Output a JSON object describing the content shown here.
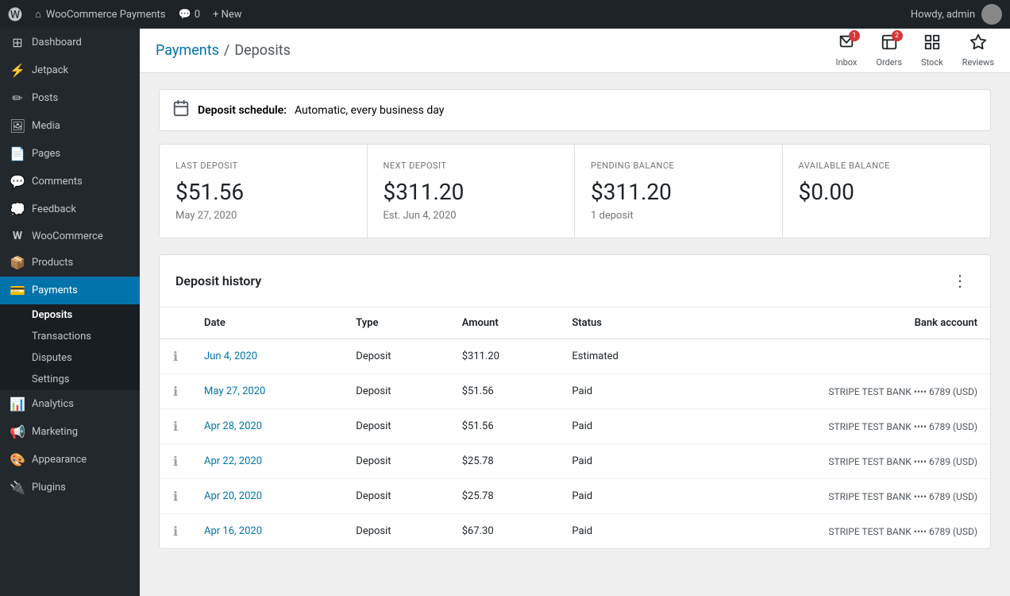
{
  "admin_bar": {
    "wp_logo": "W",
    "site_name": "WooCommerce Payments",
    "comments_icon": "💬",
    "comments_count": "0",
    "new_label": "+ New",
    "howdy": "Howdy, admin"
  },
  "sidebar": {
    "items": [
      {
        "id": "dashboard",
        "label": "Dashboard",
        "icon": "⊞"
      },
      {
        "id": "jetpack",
        "label": "Jetpack",
        "icon": "⚡"
      },
      {
        "id": "posts",
        "label": "Posts",
        "icon": "✏"
      },
      {
        "id": "media",
        "label": "Media",
        "icon": "🖼"
      },
      {
        "id": "pages",
        "label": "Pages",
        "icon": "📄"
      },
      {
        "id": "comments",
        "label": "Comments",
        "icon": "💬"
      },
      {
        "id": "feedback",
        "label": "Feedback",
        "icon": "💭"
      },
      {
        "id": "woocommerce",
        "label": "WooCommerce",
        "icon": "W"
      },
      {
        "id": "products",
        "label": "Products",
        "icon": "📦"
      },
      {
        "id": "payments",
        "label": "Payments",
        "icon": "💳",
        "active": true
      }
    ],
    "payments_submenu": [
      {
        "id": "deposits",
        "label": "Deposits",
        "active": true
      },
      {
        "id": "transactions",
        "label": "Transactions"
      },
      {
        "id": "disputes",
        "label": "Disputes"
      },
      {
        "id": "settings",
        "label": "Settings"
      }
    ],
    "bottom_items": [
      {
        "id": "analytics",
        "label": "Analytics",
        "icon": "📊"
      },
      {
        "id": "marketing",
        "label": "Marketing",
        "icon": "📢"
      },
      {
        "id": "appearance",
        "label": "Appearance",
        "icon": "🎨"
      },
      {
        "id": "plugins",
        "label": "Plugins",
        "icon": "🔌"
      }
    ]
  },
  "breadcrumb": {
    "parent_label": "Payments",
    "current_label": "Deposits"
  },
  "top_actions": [
    {
      "id": "inbox",
      "label": "Inbox",
      "icon": "📥",
      "badge": "1"
    },
    {
      "id": "orders",
      "label": "Orders",
      "icon": "📋",
      "badge": "2"
    },
    {
      "id": "stock",
      "label": "Stock",
      "icon": "⊞"
    },
    {
      "id": "reviews",
      "label": "Reviews",
      "icon": "★"
    }
  ],
  "deposit_schedule": {
    "icon": "📅",
    "label": "Deposit schedule:",
    "value": "Automatic, every business day"
  },
  "summary_cards": [
    {
      "id": "last_deposit",
      "label": "LAST DEPOSIT",
      "amount": "$51.56",
      "sub": "May 27, 2020"
    },
    {
      "id": "next_deposit",
      "label": "NEXT DEPOSIT",
      "amount": "$311.20",
      "sub": "Est. Jun 4, 2020"
    },
    {
      "id": "pending_balance",
      "label": "PENDING BALANCE",
      "amount": "$311.20",
      "sub": "1 deposit"
    },
    {
      "id": "available_balance",
      "label": "AVAILABLE BALANCE",
      "amount": "$0.00",
      "sub": ""
    }
  ],
  "deposit_history": {
    "title": "Deposit history",
    "columns": [
      "Date",
      "Type",
      "Amount",
      "Status",
      "Bank account"
    ],
    "rows": [
      {
        "date": "Jun 4, 2020",
        "type": "Deposit",
        "amount": "$311.20",
        "status": "Estimated",
        "bank": ""
      },
      {
        "date": "May 27, 2020",
        "type": "Deposit",
        "amount": "$51.56",
        "status": "Paid",
        "bank": "STRIPE TEST BANK •••• 6789 (USD)"
      },
      {
        "date": "Apr 28, 2020",
        "type": "Deposit",
        "amount": "$51.56",
        "status": "Paid",
        "bank": "STRIPE TEST BANK •••• 6789 (USD)"
      },
      {
        "date": "Apr 22, 2020",
        "type": "Deposit",
        "amount": "$25.78",
        "status": "Paid",
        "bank": "STRIPE TEST BANK •••• 6789 (USD)"
      },
      {
        "date": "Apr 20, 2020",
        "type": "Deposit",
        "amount": "$25.78",
        "status": "Paid",
        "bank": "STRIPE TEST BANK •••• 6789 (USD)"
      },
      {
        "date": "Apr 16, 2020",
        "type": "Deposit",
        "amount": "$67.30",
        "status": "Paid",
        "bank": "STRIPE TEST BANK •••• 6789 (USD)"
      }
    ]
  }
}
